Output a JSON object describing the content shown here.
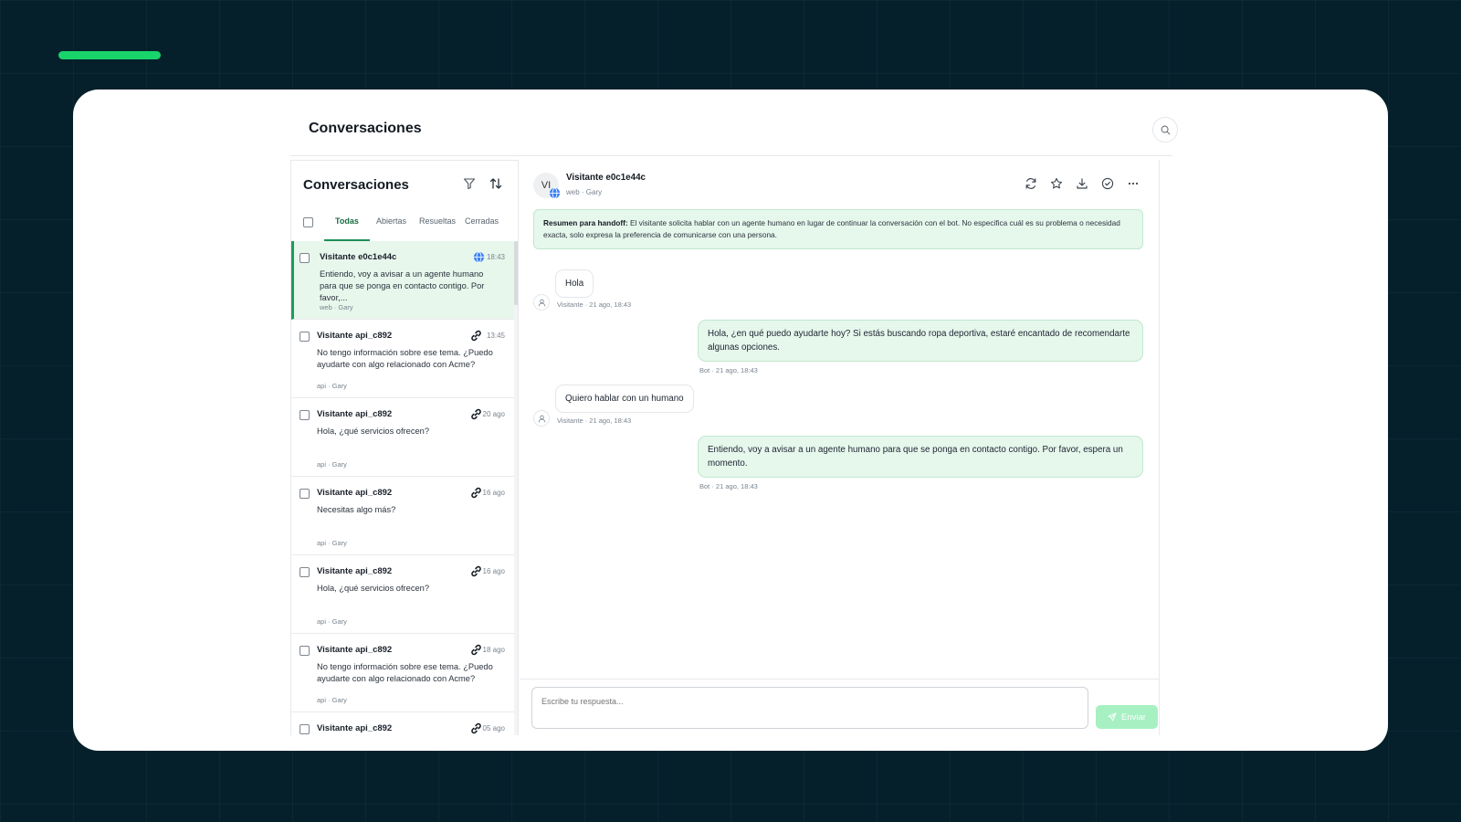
{
  "page_title": "Conversaciones",
  "left_panel": {
    "title": "Conversaciones",
    "tabs": [
      {
        "label": "Todas",
        "active": true
      },
      {
        "label": "Abiertas",
        "active": false
      },
      {
        "label": "Resueltas",
        "active": false
      },
      {
        "label": "Cerradas",
        "active": false
      }
    ],
    "conversations": [
      {
        "name": "Visitante e0c1e44c",
        "channel_icon": "globe-icon",
        "time": "18:43",
        "message": "Entiendo, voy a avisar a un agente humano para que se ponga en contacto contigo. Por favor,...",
        "meta": "web · Gary",
        "selected": true
      },
      {
        "name": "Visitante api_c892",
        "channel_icon": "link-icon",
        "time": "13:45",
        "message": "No tengo información sobre ese tema. ¿Puedo ayudarte con algo relacionado con Acme?",
        "meta": "api · Gary",
        "selected": false
      },
      {
        "name": "Visitante api_c892",
        "channel_icon": "link-icon",
        "time": "20 ago",
        "message": "Hola, ¿qué servicios ofrecen?",
        "meta": "api · Gary",
        "selected": false
      },
      {
        "name": "Visitante api_c892",
        "channel_icon": "link-icon",
        "time": "16 ago",
        "message": "Necesitas algo más?",
        "meta": "api · Gary",
        "selected": false
      },
      {
        "name": "Visitante api_c892",
        "channel_icon": "link-icon",
        "time": "16 ago",
        "message": "Hola, ¿qué servicios ofrecen?",
        "meta": "api · Gary",
        "selected": false
      },
      {
        "name": "Visitante api_c892",
        "channel_icon": "link-icon",
        "time": "18 ago",
        "message": "No tengo información sobre ese tema. ¿Puedo ayudarte con algo relacionado con Acme?",
        "meta": "api · Gary",
        "selected": false
      },
      {
        "name": "Visitante api_c892",
        "channel_icon": "link-icon",
        "time": "05 ago",
        "message": "",
        "meta": "",
        "selected": false
      }
    ]
  },
  "chat": {
    "avatar_initials": "VI",
    "visitor_name": "Visitante e0c1e44c",
    "visitor_meta": "web · Gary",
    "actions": [
      "refresh-icon",
      "star-icon",
      "download-icon",
      "check-circle-icon",
      "more-icon"
    ],
    "summary_label": "Resumen para handoff:",
    "summary_text": "El visitante solicita hablar con un agente humano en lugar de continuar la conversación con el bot. No especifica cuál es su problema o necesidad exacta, solo expresa la preferencia de comunicarse con una persona.",
    "messages": [
      {
        "sender": "visitor",
        "text": "Hola",
        "meta": "Visitante · 21 ago, 18:43"
      },
      {
        "sender": "bot",
        "text": "Hola, ¿en qué puedo ayudarte hoy? Si estás buscando ropa deportiva, estaré encantado de recomendarte algunas opciones.",
        "meta": "Bot · 21 ago, 18:43"
      },
      {
        "sender": "visitor",
        "text": "Quiero hablar con un humano",
        "meta": "Visitante · 21 ago, 18:43"
      },
      {
        "sender": "bot",
        "text": "Entiendo, voy a avisar a un agente humano para que se ponga en contacto contigo. Por favor, espera un momento.",
        "meta": "Bot · 21 ago, 18:43"
      }
    ],
    "composer_placeholder": "Escribe tu respuesta...",
    "send_label": "Enviar"
  },
  "colors": {
    "accent": "#1e9c5d",
    "bubble_bot": "#e6f7ec",
    "send_disabled": "#a7f0c2",
    "background": "#05202b"
  }
}
